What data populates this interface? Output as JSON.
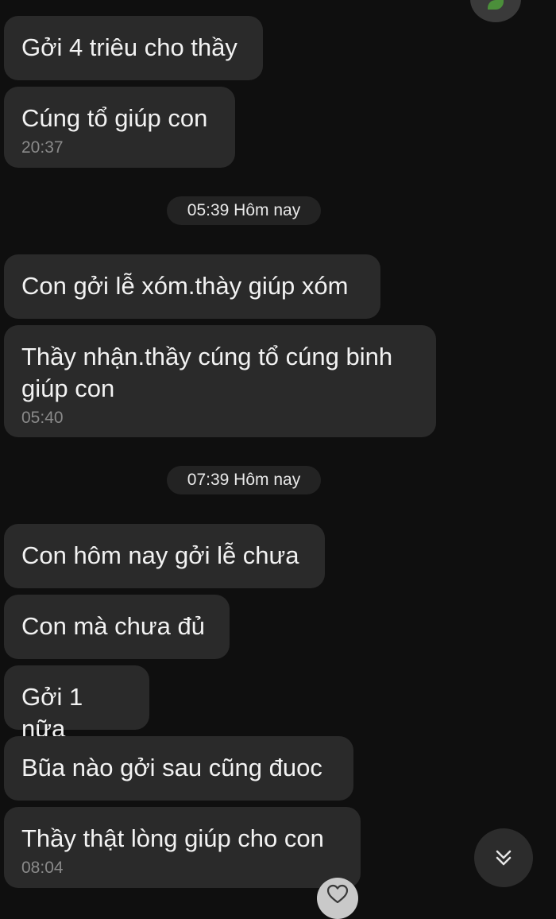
{
  "header": {
    "avatar_icon": "plant-avatar-icon"
  },
  "messages": [
    {
      "text": "Gởi 4 triêu cho thầy",
      "time": ""
    },
    {
      "text": "Cúng tổ giúp con",
      "time": "20:37"
    },
    {
      "text": "Con gởi lễ xóm.thày giúp xóm",
      "time": ""
    },
    {
      "text": "Thầy nhận.thầy cúng tổ cúng binh giúp con",
      "time": "05:40"
    },
    {
      "text": "Con hôm nay gởi lễ chưa",
      "time": ""
    },
    {
      "text": "Con mà chưa đủ",
      "time": ""
    },
    {
      "text": "Gởi 1 nữa",
      "time": ""
    },
    {
      "text": "Bũa nào gởi sau cũng đuoc",
      "time": ""
    },
    {
      "text": "Thầy thật lòng giúp cho con",
      "time": "08:04"
    }
  ],
  "date_separators": [
    {
      "label": "05:39 Hôm nay"
    },
    {
      "label": "07:39 Hôm nay"
    }
  ],
  "controls": {
    "scroll_down_icon": "double-chevron-down-icon",
    "reaction_icon": "heart-icon"
  },
  "colors": {
    "background": "#0f0f0f",
    "bubble": "#2a2a2a",
    "pill": "#232323",
    "time_text": "#8a8a8a"
  }
}
